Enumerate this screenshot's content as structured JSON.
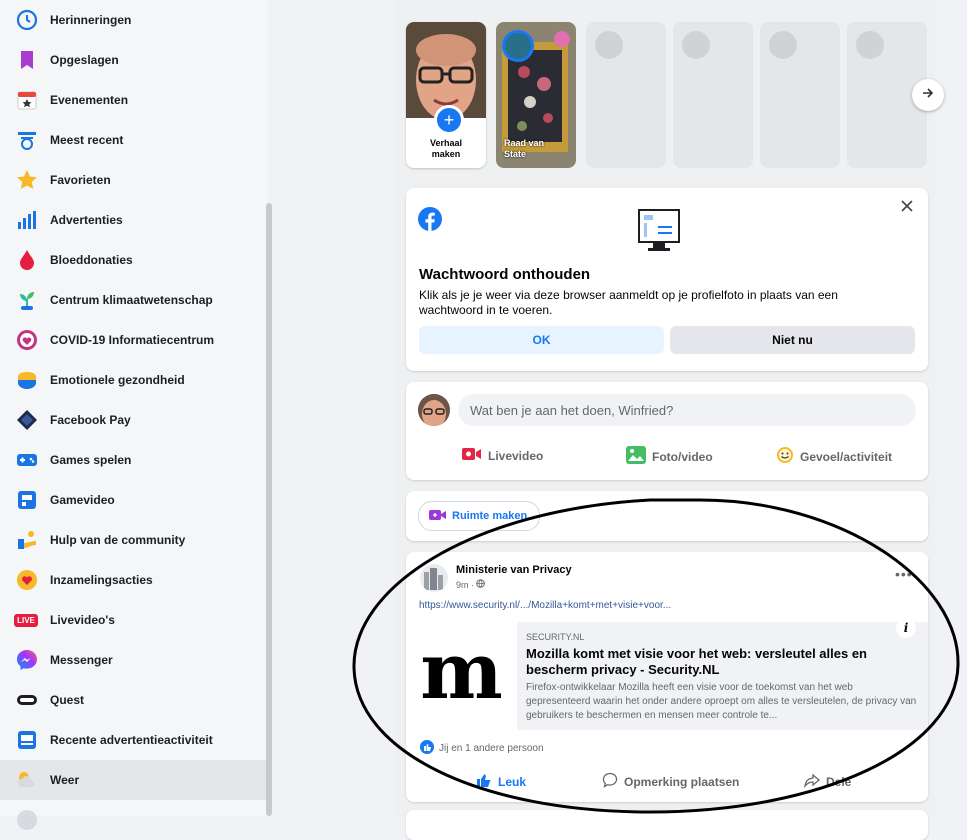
{
  "sidebar": {
    "items": [
      {
        "label": "Herinneringen",
        "icon": "clock-icon"
      },
      {
        "label": "Opgeslagen",
        "icon": "bookmark-icon"
      },
      {
        "label": "Evenementen",
        "icon": "calendar-icon"
      },
      {
        "label": "Meest recent",
        "icon": "recent-icon"
      },
      {
        "label": "Favorieten",
        "icon": "star-icon"
      },
      {
        "label": "Advertenties",
        "icon": "ads-chart-icon"
      },
      {
        "label": "Bloeddonaties",
        "icon": "blood-drop-icon"
      },
      {
        "label": "Centrum klimaatwetenschap",
        "icon": "plant-icon"
      },
      {
        "label": "COVID-19 Informatiecentrum",
        "icon": "heart-shield-icon"
      },
      {
        "label": "Emotionele gezondheid",
        "icon": "emotional-health-icon"
      },
      {
        "label": "Facebook Pay",
        "icon": "pay-diamond-icon"
      },
      {
        "label": "Games spelen",
        "icon": "gamepad-icon"
      },
      {
        "label": "Gamevideo",
        "icon": "gamevideo-icon"
      },
      {
        "label": "Hulp van de community",
        "icon": "community-help-icon"
      },
      {
        "label": "Inzamelingsacties",
        "icon": "fundraiser-icon"
      },
      {
        "label": "Livevideo's",
        "icon": "live-icon",
        "badge": "LIVE"
      },
      {
        "label": "Messenger",
        "icon": "messenger-icon"
      },
      {
        "label": "Quest",
        "icon": "vr-headset-icon"
      },
      {
        "label": "Recente advertentieactiviteit",
        "icon": "ad-activity-icon"
      },
      {
        "label": "Weer",
        "icon": "weather-icon"
      }
    ]
  },
  "stories": {
    "create_label": "Verhaal maken",
    "second_label": "Raad van State",
    "next_icon": "arrow-right-icon"
  },
  "password_card": {
    "title": "Wachtwoord onthouden",
    "body": "Klik als je je weer via deze browser aanmeldt op je profielfoto in plaats van een wachtwoord in te voeren.",
    "ok_label": "OK",
    "not_now_label": "Niet nu"
  },
  "composer": {
    "placeholder": "Wat ben je aan het doen, Winfried?",
    "live_label": "Livevideo",
    "photo_label": "Foto/video",
    "feeling_label": "Gevoel/activiteit"
  },
  "rooms": {
    "create_label": "Ruimte maken"
  },
  "post": {
    "author": "Ministerie van Privacy",
    "time": "9m · ",
    "link_text": "https://www.security.nl/.../Mozilla+komt+met+visie+voor...",
    "preview_source": "SECURITY.NL",
    "preview_title": "Mozilla komt met visie voor het web: versleutel alles en bescherm privacy - Security.NL",
    "preview_desc": "Firefox-ontwikkelaar Mozilla heeft een visie voor de toekomst van het web gepresenteerd waarin het onder andere oproept om alles te versleutelen, de privacy van gebruikers te beschermen en mensen meer controle te...",
    "preview_logo": "m",
    "reactions": "Jij en 1 andere persoon",
    "like_label": "Leuk",
    "comment_label": "Opmerking plaatsen",
    "share_label": "Dele"
  },
  "colors": {
    "brand": "#1877f2",
    "sidebar_bg": "#f5f6f7",
    "feed_bg": "#eef0f2",
    "ok_bg": "#e7f3ff",
    "secondary_btn": "#e4e6eb"
  }
}
